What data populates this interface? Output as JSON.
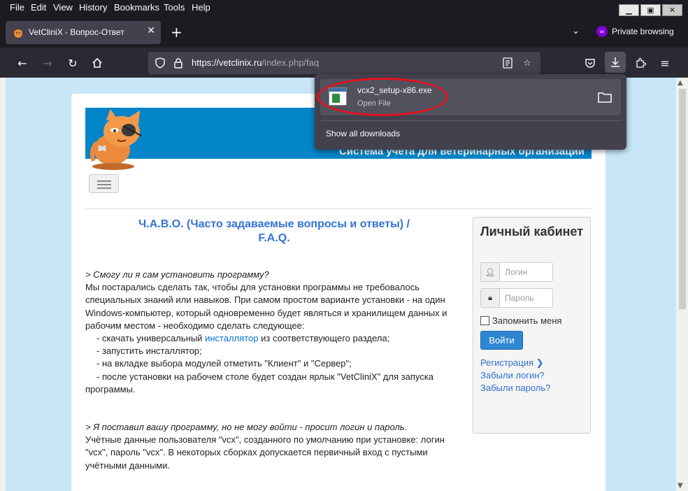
{
  "menu": {
    "file": "File",
    "edit": "Edit",
    "view": "View",
    "history": "History",
    "bookmarks": "Bookmarks",
    "tools": "Tools",
    "help": "Help"
  },
  "tab": {
    "title": "VetCliniX - Вопрос-Ответ"
  },
  "private_label": "Private browsing",
  "url": {
    "host": "https://vetclinix.ru",
    "path": "/index.php/faq"
  },
  "downloads": {
    "file_name": "vcx2_setup-x86.exe",
    "status": "Open File",
    "show_all": "Show all downloads"
  },
  "page": {
    "banner_text": "Система учета для ветеринарных организаций",
    "faq_title": "Ч.А.В.О. (Часто задаваемые вопросы и ответы) / F.A.Q.",
    "q1": "> Смогу ли я сам установить программу?",
    "a1_p1": "Мы постарались сделать так, чтобы для установки программы не требовалось специальных знаний или навыков. При самом простом варианте установки - на один Windows-компьютер, который одновременно будет являться и хранилищем данных и рабочим местом - необходимо сделать следующее:",
    "a1_s1_pre": "- скачать универсальный ",
    "a1_s1_link": "инсталлятор",
    "a1_s1_post": " из соответствующего раздела;",
    "a1_s2": "- запустить инсталлятор;",
    "a1_s3": "- на вкладке выбора модулей отметить \"Клиент\" и \"Сервер\";",
    "a1_s4": "- после установки на рабочем столе будет создан ярлык \"VetCliniX\" для запуска программы.",
    "q2": "> Я поставил вашу программу, но не могу войти - просит логин и пароль.",
    "a2": "Учётные данные пользователя \"vcx\", созданного по умолчанию при установке: логин \"vcx\", пароль \"vcx\". В некоторых сборках допускается первичный вход с пустыми учётными данными."
  },
  "login": {
    "title": "Личный кабинет",
    "login_placeholder": "Логин",
    "password_placeholder": "Пароль",
    "remember": "Запомнить меня",
    "submit": "Войти",
    "register": "Регистрация",
    "forgot_login": "Забыли логин?",
    "forgot_password": "Забыли пароль?"
  },
  "colors": {
    "accent": "#0585c9",
    "link": "#2f6fd1",
    "highlight": "#e3101e"
  }
}
